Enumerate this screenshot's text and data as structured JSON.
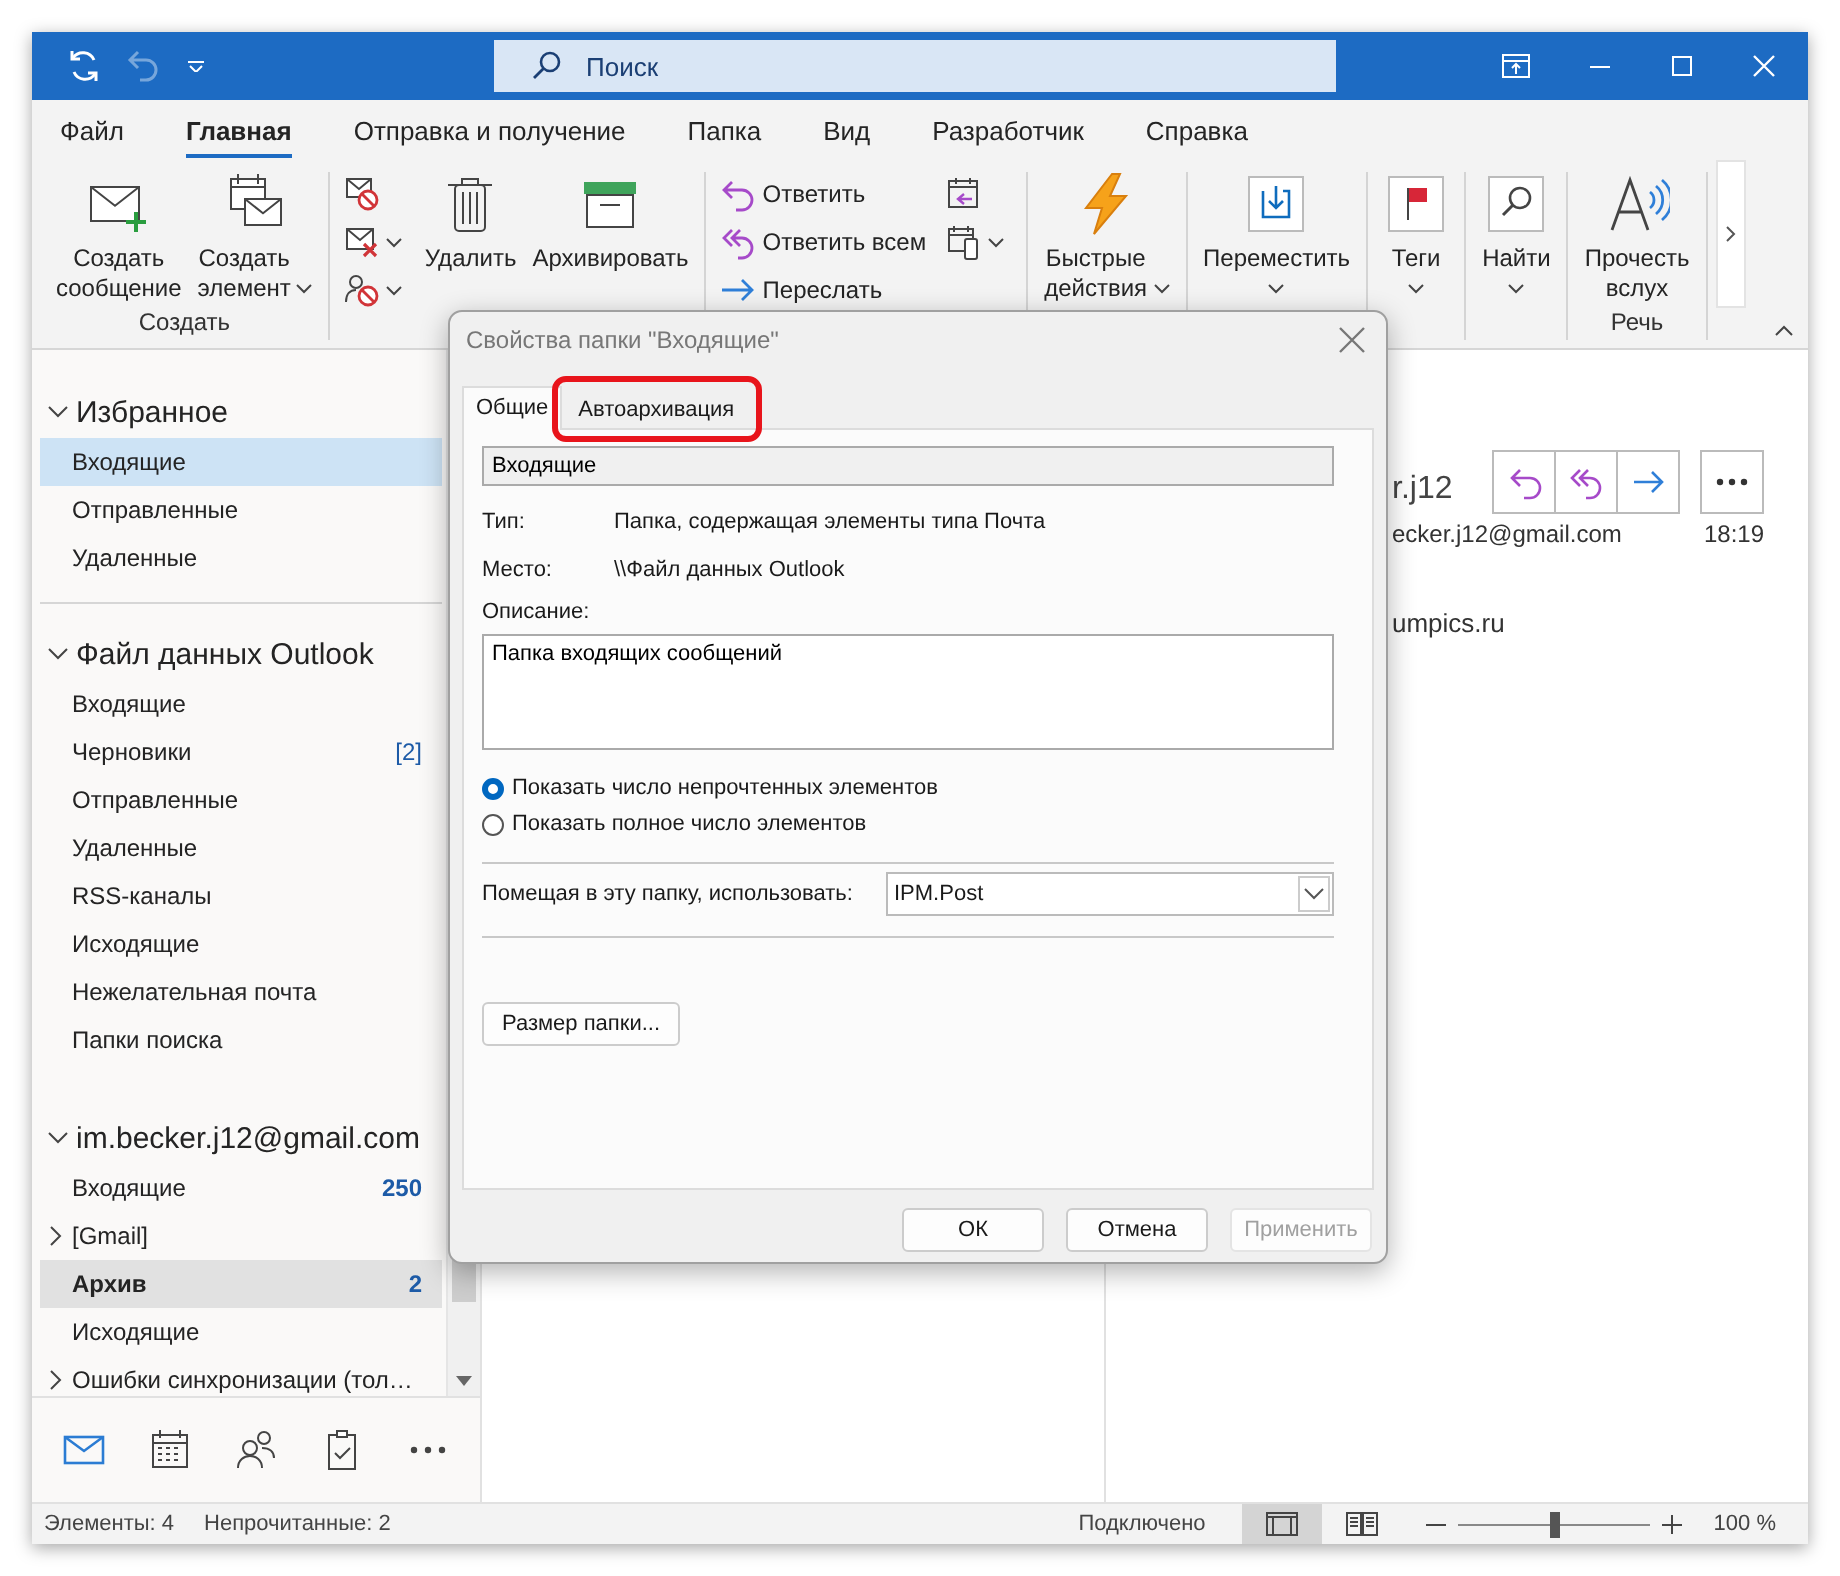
{
  "titlebar": {
    "undo": {
      "disabled": true
    },
    "search": {
      "placeholder": "Поиск"
    }
  },
  "tabs": [
    {
      "label": "Файл",
      "selected": false
    },
    {
      "label": "Главная",
      "selected": true
    },
    {
      "label": "Отправка и получение",
      "selected": false
    },
    {
      "label": "Папка",
      "selected": false
    },
    {
      "label": "Вид",
      "selected": false
    },
    {
      "label": "Разработчик",
      "selected": false
    },
    {
      "label": "Справка",
      "selected": false
    }
  ],
  "ribbon": {
    "groups": [
      {
        "label": "Создать",
        "buttons": [
          {
            "kind": "large",
            "label": "Создать сообщение"
          },
          {
            "kind": "large",
            "label": "Создать элемент",
            "dropdown": true
          }
        ]
      },
      {
        "buttons": [
          {
            "kind": "small"
          },
          {
            "kind": "small",
            "dropdown": true
          },
          {
            "kind": "small",
            "dropdown": true
          },
          {
            "kind": "large",
            "label": "Удалить"
          },
          {
            "kind": "large",
            "label": "Архивировать"
          }
        ]
      },
      {
        "buttons": [
          {
            "kind": "small",
            "label": "Ответить"
          },
          {
            "kind": "small",
            "label": "Ответить всем"
          },
          {
            "kind": "small",
            "label": "Переслать"
          },
          {
            "kind": "small"
          },
          {
            "kind": "small",
            "dropdown": true
          }
        ]
      },
      {
        "buttons": [
          {
            "kind": "large",
            "label": "Быстрые действия",
            "dropdown": true
          }
        ]
      },
      {
        "buttons": [
          {
            "kind": "stacked",
            "label": "Переместить",
            "dropdown": true
          }
        ]
      },
      {
        "buttons": [
          {
            "kind": "stacked",
            "label": "Теги",
            "dropdown": true
          }
        ]
      },
      {
        "buttons": [
          {
            "kind": "stacked",
            "label": "Найти",
            "dropdown": true
          }
        ]
      },
      {
        "label": "Речь",
        "buttons": [
          {
            "kind": "large",
            "label": "Прочесть вслух"
          }
        ]
      }
    ]
  },
  "sidebar": {
    "sections": [
      {
        "title": "Избранное",
        "items": [
          {
            "label": "Входящие",
            "selected": true,
            "hovered": false,
            "unread": false
          },
          {
            "label": "Отправленные",
            "selected": false,
            "hovered": false,
            "unread": false
          },
          {
            "label": "Удаленные",
            "selected": false,
            "hovered": false,
            "unread": false
          }
        ]
      },
      {
        "title": "Файл данных Outlook",
        "items": [
          {
            "label": "Входящие",
            "selected": false,
            "hovered": false,
            "unread": false
          },
          {
            "label": "Черновики",
            "selected": false,
            "hovered": false,
            "unread": false,
            "count": "[2]",
            "count_unread": false
          },
          {
            "label": "Отправленные",
            "selected": false,
            "hovered": false,
            "unread": false
          },
          {
            "label": "Удаленные",
            "selected": false,
            "hovered": false,
            "unread": false
          },
          {
            "label": "RSS-каналы",
            "selected": false,
            "hovered": false,
            "unread": false
          },
          {
            "label": "Исходящие",
            "selected": false,
            "hovered": false,
            "unread": false
          },
          {
            "label": "Нежелательная почта",
            "selected": false,
            "hovered": false,
            "unread": false
          },
          {
            "label": "Папки поиска",
            "selected": false,
            "hovered": false,
            "unread": false
          }
        ]
      },
      {
        "title": "im.becker.j12@gmail.com",
        "items": [
          {
            "label": "Входящие",
            "selected": false,
            "hovered": false,
            "unread": false,
            "count": "250",
            "count_unread": true
          },
          {
            "label": "[Gmail]",
            "selected": false,
            "hovered": false,
            "unread": false,
            "collapsed": true
          },
          {
            "label": "Архив",
            "selected": false,
            "hovered": true,
            "unread": true,
            "count": "2",
            "count_unread": true
          },
          {
            "label": "Исходящие",
            "selected": false,
            "hovered": false,
            "unread": false
          },
          {
            "label": "Ошибки синхронизации (тол…",
            "selected": false,
            "hovered": false,
            "unread": false,
            "collapsed": true
          }
        ]
      }
    ]
  },
  "nav": [
    {
      "selected": true
    },
    {
      "selected": false
    },
    {
      "selected": false
    },
    {
      "selected": false
    },
    {
      "selected": false
    }
  ],
  "reading_pane": {
    "sender": "r.j12",
    "email": "ecker.j12@gmail.com",
    "time": "18:19",
    "body": "umpics.ru"
  },
  "status_bar": {
    "items": "Элементы: 4",
    "unread": "Непрочитанные: 2",
    "connection": "Подключено",
    "views": [
      {
        "selected": true
      },
      {
        "selected": false
      }
    ],
    "zoom": {
      "level": 0.5,
      "reading": "100 %"
    }
  },
  "dialog": {
    "title": "Свойства папки \"Входящие\"",
    "tabs": [
      {
        "label": "Общие",
        "selected": true,
        "highlighted": false
      },
      {
        "label": "Автоархивация",
        "selected": false,
        "highlighted": true
      }
    ],
    "name": "Входящие",
    "fields": [
      {
        "label": "Тип:",
        "value": "Папка, содержащая элементы типа Почта"
      },
      {
        "label": "Место:",
        "value": "\\\\Файл данных Outlook"
      }
    ],
    "description": {
      "label": "Описание:",
      "value": "Папка входящих сообщений"
    },
    "radios": [
      {
        "label": "Показать число непрочтенных элементов",
        "selected": true
      },
      {
        "label": "Показать полное число элементов",
        "selected": false
      }
    ],
    "post_form": {
      "label": "Помещая в эту папку, использовать:",
      "value": "IPM.Post"
    },
    "size_button": "Размер папки...",
    "buttons": [
      {
        "label": "ОК",
        "disabled": false
      },
      {
        "label": "Отмена",
        "disabled": false
      },
      {
        "label": "Применить",
        "disabled": true
      }
    ]
  }
}
